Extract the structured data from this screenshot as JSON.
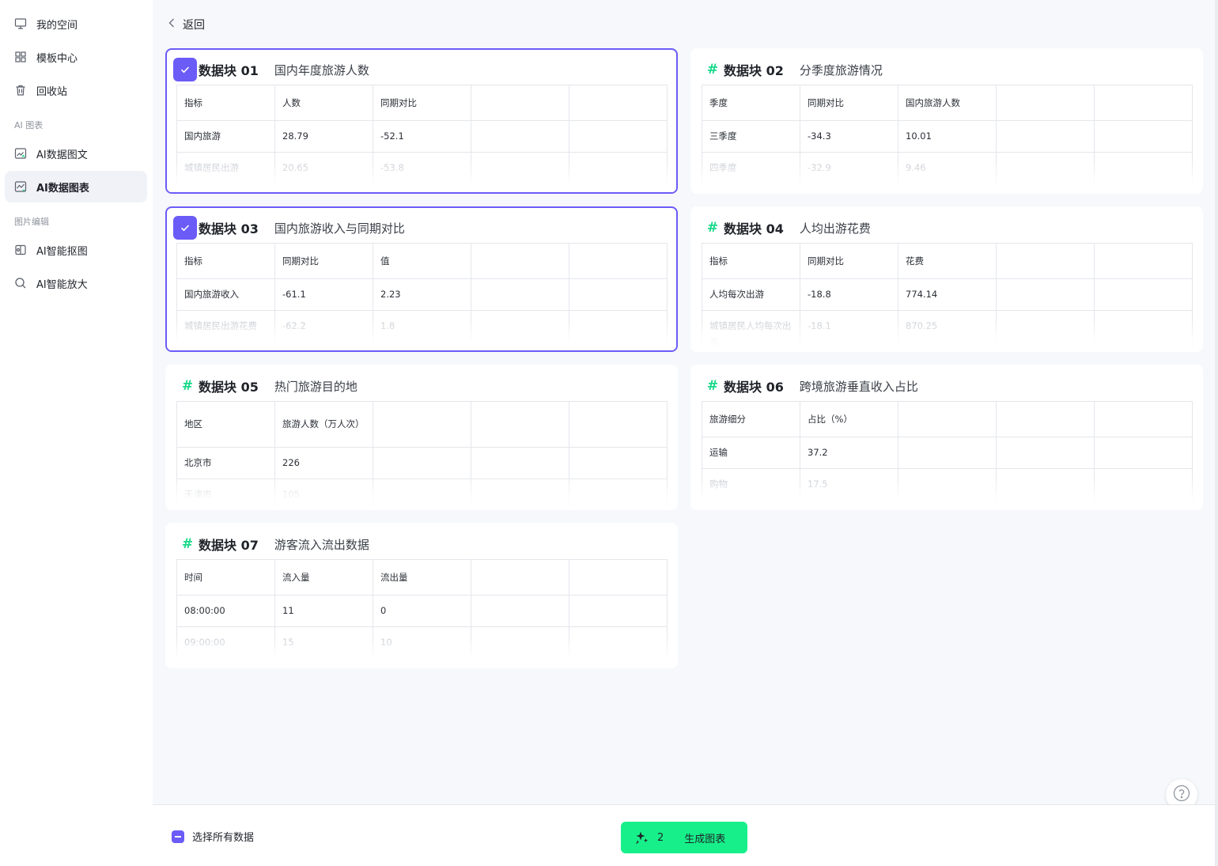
{
  "sidebar": {
    "items": [
      {
        "label": "我的空间",
        "icon": "monitor-icon"
      },
      {
        "label": "模板中心",
        "icon": "grid-icon"
      },
      {
        "label": "回收站",
        "icon": "trash-icon"
      }
    ],
    "group_chart": "AI 图表",
    "chart_items": [
      {
        "label": "AI数据图文",
        "icon": "image-chart-icon"
      },
      {
        "label": "AI数据图表",
        "icon": "line-chart-icon",
        "active": true
      }
    ],
    "group_image": "图片编辑",
    "image_items": [
      {
        "label": "AI智能抠图",
        "icon": "cutout-icon"
      },
      {
        "label": "AI智能放大",
        "icon": "zoom-icon"
      }
    ]
  },
  "main": {
    "back_label": "返回",
    "blocks": [
      {
        "id": "数据块 01",
        "title": "国内年度旅游人数",
        "selected": true,
        "headers": [
          "指标",
          "人数",
          "同期对比",
          "",
          ""
        ],
        "rows": [
          [
            "国内旅游",
            "28.79",
            "-52.1",
            "",
            ""
          ]
        ],
        "faded_row": [
          "城镇居民出游",
          "20.65",
          "-53.8",
          "",
          ""
        ]
      },
      {
        "id": "数据块 02",
        "title": "分季度旅游情况",
        "selected": false,
        "headers": [
          "季度",
          "同期对比",
          "国内旅游人数",
          "",
          ""
        ],
        "rows": [
          [
            "三季度",
            "-34.3",
            "10.01",
            "",
            ""
          ]
        ],
        "faded_row": [
          "四季度",
          "-32.9",
          "9.46",
          "",
          ""
        ]
      },
      {
        "id": "数据块 03",
        "title": "国内旅游收入与同期对比",
        "selected": true,
        "headers": [
          "指标",
          "同期对比",
          "值",
          "",
          ""
        ],
        "rows": [
          [
            "国内旅游收入",
            "-61.1",
            "2.23",
            "",
            ""
          ]
        ],
        "faded_row": [
          "城镇居民出游花费",
          "-62.2",
          "1.8",
          "",
          ""
        ]
      },
      {
        "id": "数据块 04",
        "title": "人均出游花费",
        "selected": false,
        "headers": [
          "指标",
          "同期对比",
          "花费",
          "",
          ""
        ],
        "rows": [
          [
            "人均每次出游",
            "-18.8",
            "774.14",
            "",
            ""
          ]
        ],
        "faded_row": [
          "城镇居民人均每次出游",
          "-18.1",
          "870.25",
          "",
          ""
        ]
      },
      {
        "id": "数据块 05",
        "title": "热门旅游目的地",
        "selected": false,
        "headers": [
          "地区",
          "旅游人数（万人次）",
          "",
          "",
          ""
        ],
        "rows": [
          [
            "北京市",
            "226",
            "",
            "",
            ""
          ]
        ],
        "faded_row": [
          "天津市",
          "105",
          "",
          "",
          ""
        ]
      },
      {
        "id": "数据块 06",
        "title": "跨境旅游垂直收入占比",
        "selected": false,
        "headers": [
          "旅游细分",
          "占比（%）",
          "",
          "",
          ""
        ],
        "rows": [
          [
            "运输",
            "37.2",
            "",
            "",
            ""
          ]
        ],
        "faded_row": [
          "购物",
          "17.5",
          "",
          "",
          ""
        ]
      },
      {
        "id": "数据块 07",
        "title": "游客流入流出数据",
        "selected": false,
        "headers": [
          "时间",
          "流入量",
          "流出量",
          "",
          ""
        ],
        "rows": [
          [
            "08:00:00",
            "11",
            "0",
            "",
            ""
          ]
        ],
        "faded_row": [
          "09:00:00",
          "15",
          "10",
          "",
          ""
        ]
      }
    ]
  },
  "footer": {
    "select_all_label": "选择所有数据",
    "selected_count": "2",
    "generate_label": "生成图表"
  },
  "colors": {
    "accent": "#6b5bf7",
    "hash": "#17d98a",
    "generate": "#17f08a"
  }
}
